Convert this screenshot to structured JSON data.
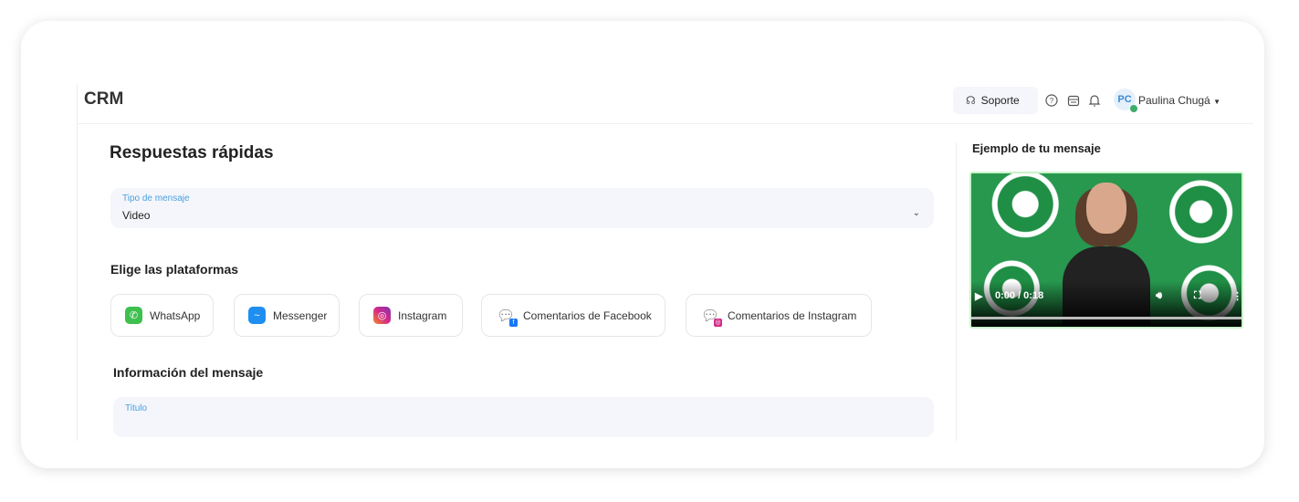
{
  "header": {
    "app_title": "CRM",
    "support_label": "Soporte",
    "user_initials": "PC",
    "user_name": "Paulina Chugá"
  },
  "page": {
    "title": "Respuestas rápidas"
  },
  "message_type": {
    "label": "Tipo de mensaje",
    "value": "Video"
  },
  "platforms": {
    "heading": "Elige las plataformas",
    "items": [
      {
        "label": "WhatsApp",
        "color": "#3fbf4f"
      },
      {
        "label": "Messenger",
        "color": "#1e8ef0"
      },
      {
        "label": "Instagram",
        "color": "#d42b8a"
      },
      {
        "label": "Comentarios de Facebook",
        "color": "#1877f2"
      },
      {
        "label": "Comentarios de Instagram",
        "color": "#d42b8a"
      }
    ]
  },
  "message_info": {
    "heading": "Información del mensaje",
    "title_label": "Titulo"
  },
  "preview": {
    "heading": "Ejemplo de tu mensaje",
    "video_time": "0:00 / 0:18",
    "progress": 0
  }
}
